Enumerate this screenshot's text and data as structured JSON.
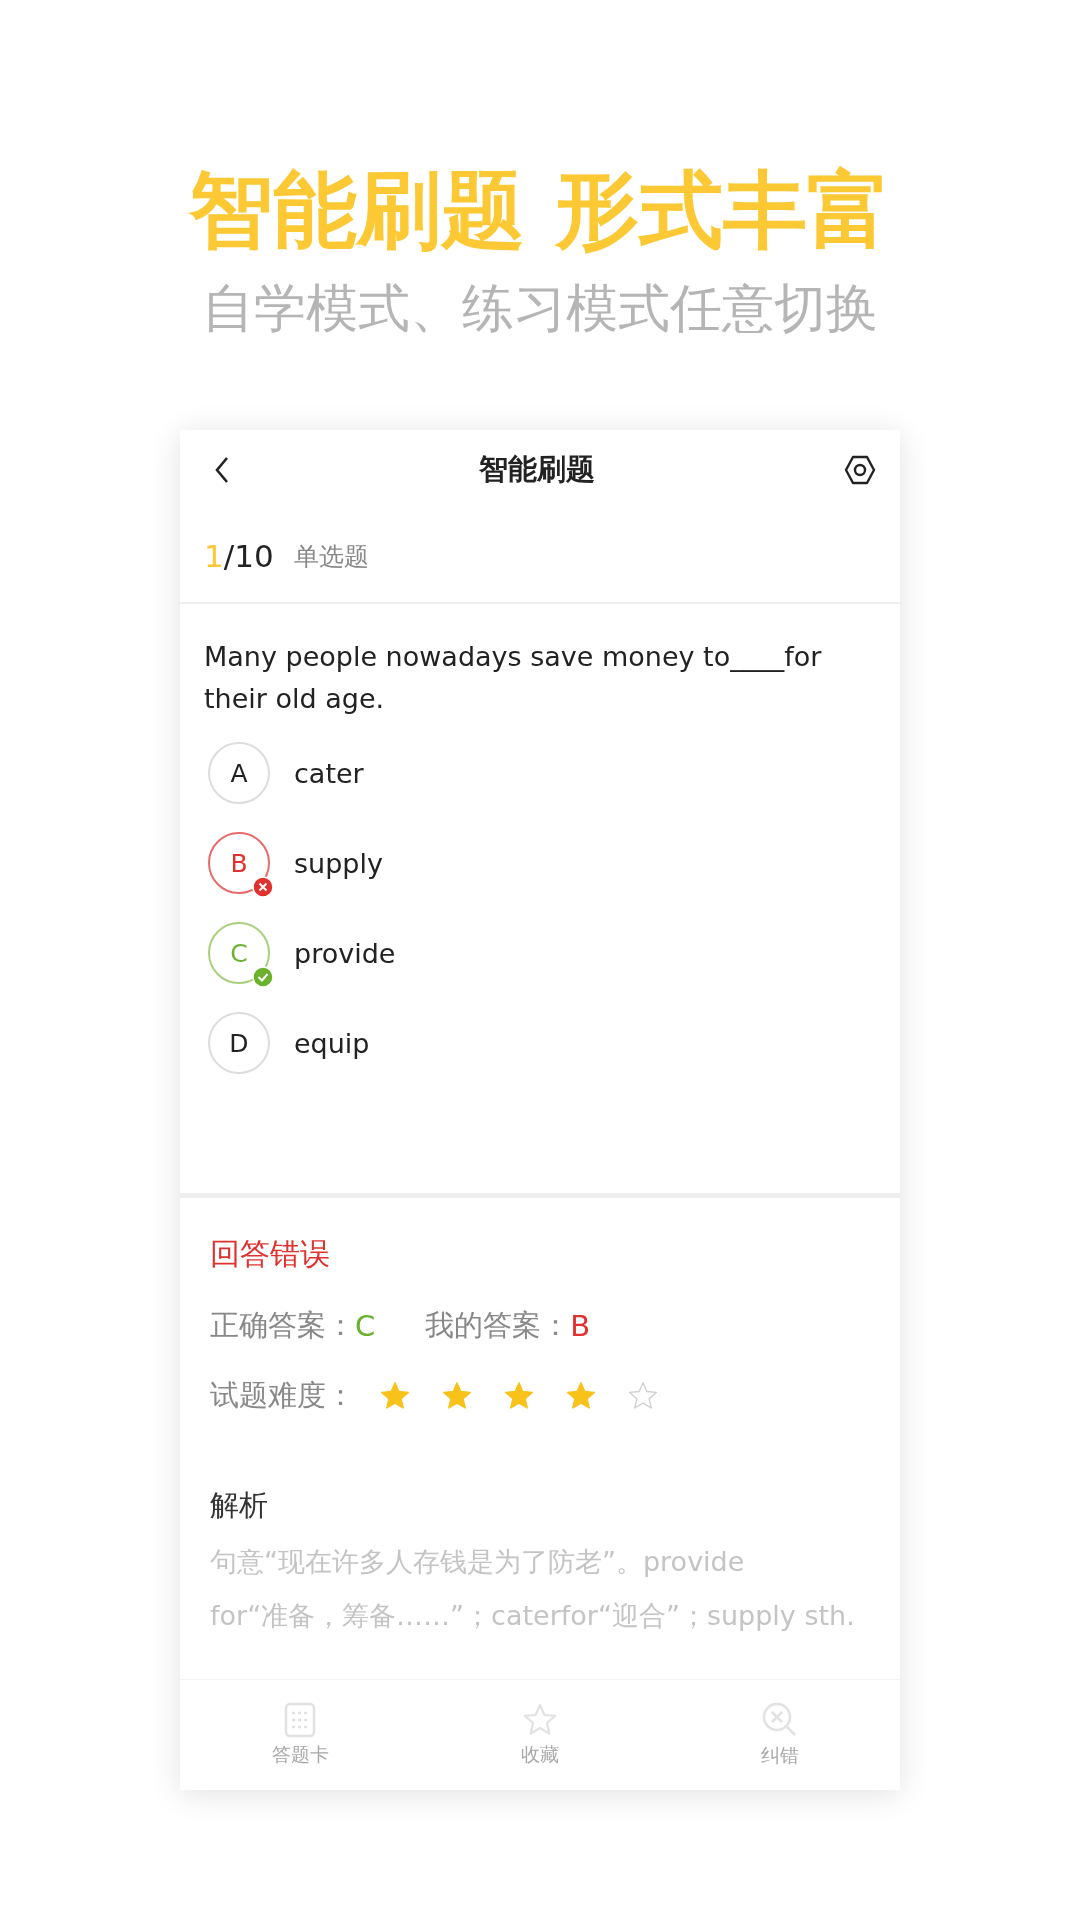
{
  "headline": "智能刷题 形式丰富",
  "subtitle": "自学模式、练习模式任意切换",
  "screen": {
    "title": "智能刷题",
    "progress": {
      "current": "1",
      "total": "/10",
      "type": "单选题"
    },
    "question": "Many people nowadays save money to____for their old age.",
    "options": [
      {
        "letter": "A",
        "text": "cater",
        "kind": "normal"
      },
      {
        "letter": "B",
        "text": "supply",
        "kind": "wrong"
      },
      {
        "letter": "C",
        "text": "provide",
        "kind": "correct"
      },
      {
        "letter": "D",
        "text": "equip",
        "kind": "normal"
      }
    ],
    "result": {
      "verdict": "回答错误",
      "correct_label": "正确答案：",
      "correct_value": "C",
      "mine_label": "我的答案：",
      "mine_value": "B",
      "difficulty_label": "试题难度：",
      "stars": 4
    },
    "analysis": {
      "title": "解析",
      "lines": [
        "句意“现在许多人存钱是为了防老”。provide",
        "for“准备，筹备……”；caterfor“迎合”；supply sth."
      ]
    },
    "bottom_nav": [
      {
        "label": "答题卡"
      },
      {
        "label": "收藏"
      },
      {
        "label": "纠错"
      }
    ]
  }
}
